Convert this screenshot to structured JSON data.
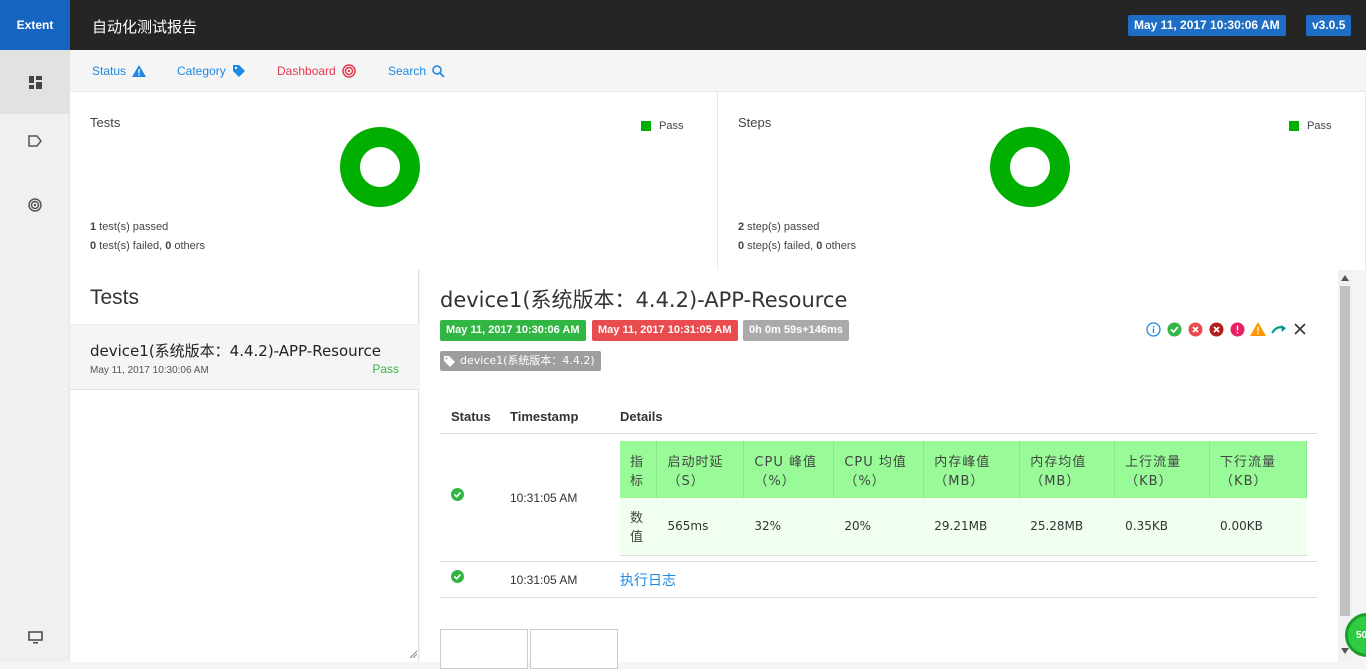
{
  "header": {
    "brand": "Extent",
    "report_title": "自动化测试报告",
    "date_badge": "May 11, 2017 10:30:06 AM",
    "version_badge": "v3.0.5"
  },
  "sidebar": {
    "items": [
      {
        "icon": "dashboard-grid-icon"
      },
      {
        "icon": "tag-outline-icon"
      },
      {
        "icon": "radar-icon"
      },
      {
        "icon": "monitor-icon"
      }
    ]
  },
  "subnav": {
    "status": "Status",
    "category": "Category",
    "dashboard": "Dashboard",
    "search": "Search"
  },
  "summary": {
    "tests": {
      "title": "Tests",
      "legend": "Pass",
      "passed_count": "1",
      "passed_text": " test(s) passed",
      "failed_count": "0",
      "failed_text": " test(s) failed, ",
      "others_count": "0",
      "others_text": " others"
    },
    "steps": {
      "title": "Steps",
      "legend": "Pass",
      "passed_count": "2",
      "passed_text": " step(s) passed",
      "failed_count": "0",
      "failed_text": " step(s) failed, ",
      "others_count": "0",
      "others_text": " others"
    },
    "pass_color": "#00af00"
  },
  "tests_list": {
    "heading": "Tests",
    "items": [
      {
        "name": "device1(系统版本：4.4.2)-APP-Resource",
        "time": "May 11, 2017 10:30:06 AM",
        "status": "Pass"
      }
    ]
  },
  "detail": {
    "title": "device1(系统版本：4.4.2)-APP-Resource",
    "start_time": "May 11, 2017 10:30:06 AM",
    "end_time": "May 11, 2017 10:31:05 AM",
    "duration": "0h 0m 59s+146ms",
    "category_tag": "device1(系统版本：4.4.2)",
    "columns": {
      "status": "Status",
      "timestamp": "Timestamp",
      "details": "Details"
    },
    "steps": [
      {
        "timestamp": "10:31:05 AM",
        "metrics_header": {
          "c0a": "指",
          "c0b": "标",
          "c1a": "启动时延",
          "c1b": "（S）",
          "c2a": "CPU 峰值",
          "c2b": "（%）",
          "c3a": "CPU 均值",
          "c3b": "（%）",
          "c4a": "内存峰值",
          "c4b": "（MB）",
          "c5a": "内存均值",
          "c5b": "（MB）",
          "c6a": "上行流量",
          "c6b": "（KB）",
          "c7a": "下行流量",
          "c7b": "（KB）"
        },
        "metrics_values": {
          "c0a": "数",
          "c0b": "值",
          "c1": "565ms",
          "c2": "32%",
          "c3": "20%",
          "c4": "29.21MB",
          "c5": "25.28MB",
          "c6": "0.35KB",
          "c7": "0.00KB"
        }
      },
      {
        "timestamp": "10:31:05 AM",
        "detail_link": "执行日志"
      }
    ]
  },
  "fab_text": "50"
}
